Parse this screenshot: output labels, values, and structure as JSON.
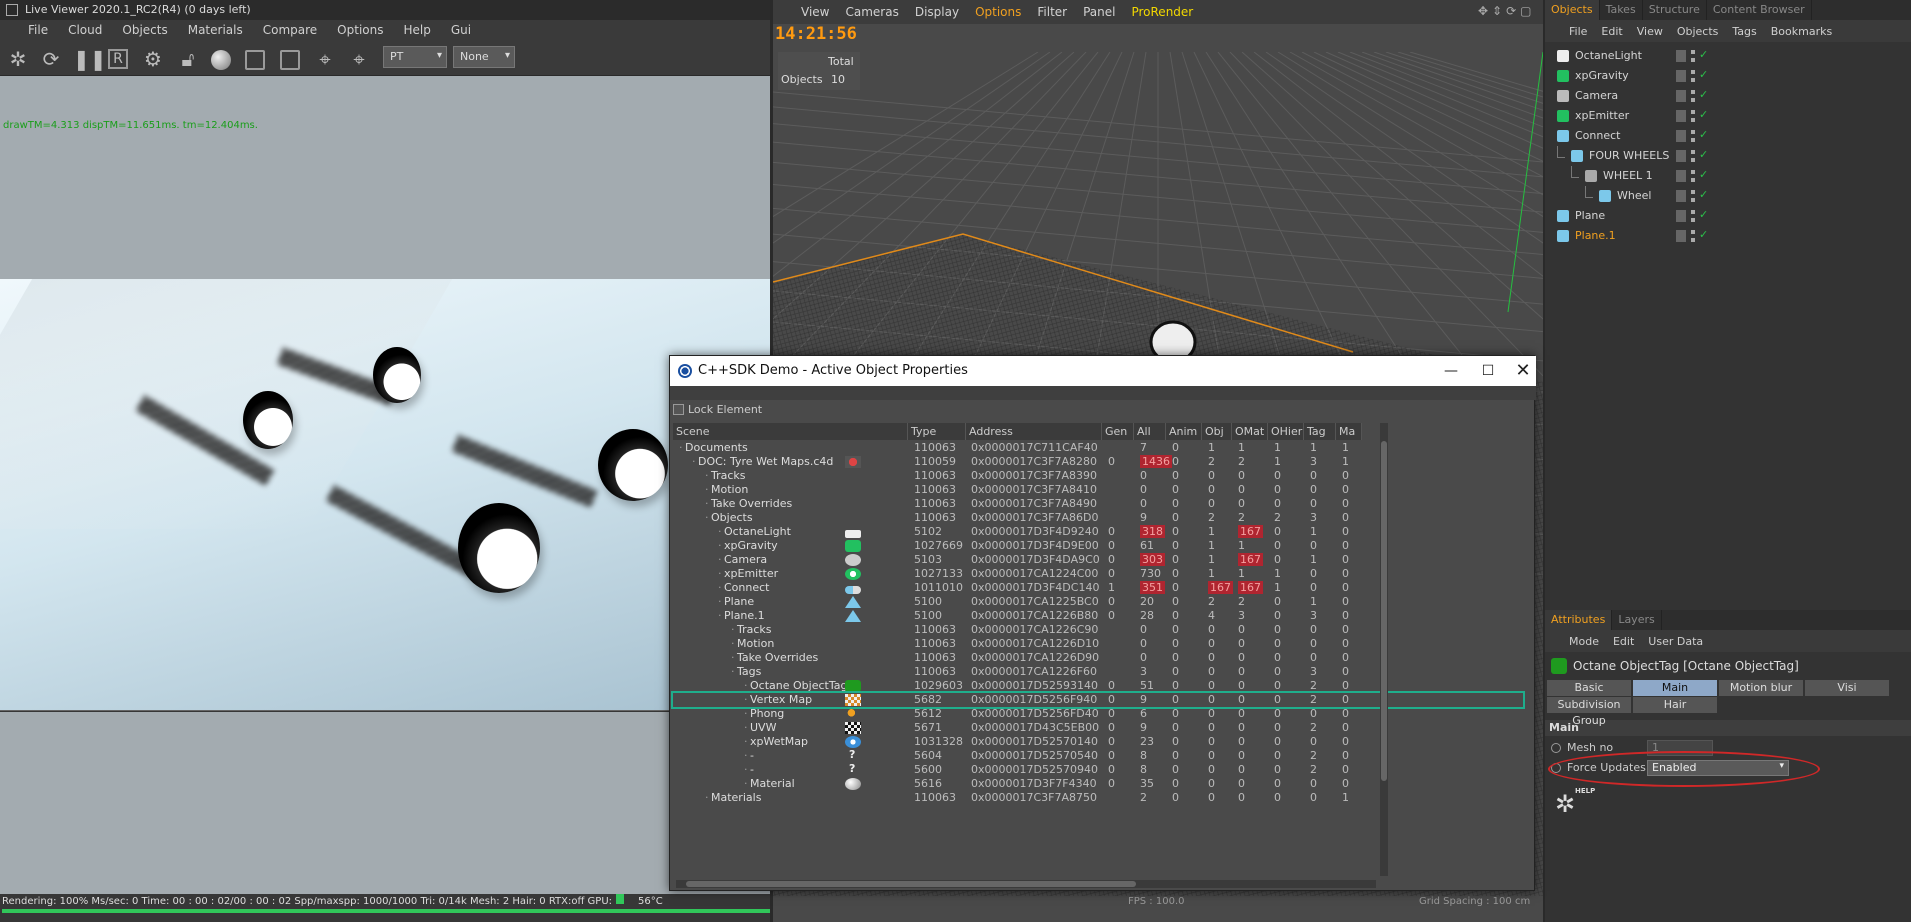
{
  "live_viewer": {
    "title": "Live Viewer 2020.1_RC2(R4) (0 days left)",
    "menu": [
      "File",
      "Cloud",
      "Objects",
      "Materials",
      "Compare",
      "Options",
      "Help",
      "Gui"
    ],
    "toolbar_icons": [
      "octane-logo-icon",
      "refresh-icon",
      "pause-icon",
      "region-icon",
      "settings-icon",
      "lock-icon",
      "material-ball-icon",
      "square-icon",
      "square-icon",
      "pin-p-icon",
      "pin-m-icon"
    ],
    "toolbar_region_label": "R",
    "mode_dropdown": "PT",
    "second_dropdown": "None",
    "stats": "drawTM=4.313 dispTM=11.651ms.   tm=12.404ms.",
    "status": "Rendering: 100%  Ms/sec: 0   Time: 00 : 00 : 02/00 : 00 : 02  Spp/maxspp: 1000/1000   Tri: 0/14k   Mesh: 2  Hair: 0   RTX:off       GPU:",
    "gpu_temp": "56°C",
    "progress": 1.0
  },
  "editor": {
    "menu": [
      "View",
      "Cameras",
      "Display",
      "Options",
      "Filter",
      "Panel",
      "ProRender"
    ],
    "active_menu": "Options",
    "clock": "14:21:56",
    "hud_header": "Total",
    "hud_label": "Objects",
    "hud_value": "10",
    "fps": "FPS : 100.0",
    "grid_spacing": "Grid Spacing : 100 cm"
  },
  "object_manager": {
    "tabs": [
      "Objects",
      "Takes",
      "Structure",
      "Content Browser"
    ],
    "menu": [
      "File",
      "Edit",
      "View",
      "Objects",
      "Tags",
      "Bookmarks"
    ],
    "objects": [
      {
        "name": "OctaneLight",
        "depth": 0,
        "color": "#eeeeee"
      },
      {
        "name": "xpGravity",
        "depth": 0,
        "color": "#22c060"
      },
      {
        "name": "Camera",
        "depth": 0,
        "color": "#bbbbbb"
      },
      {
        "name": "xpEmitter",
        "depth": 0,
        "color": "#22c060"
      },
      {
        "name": "Connect",
        "depth": 0,
        "color": "#7cc8ea"
      },
      {
        "name": "FOUR WHEELS",
        "depth": 1,
        "color": "#7cc8ea"
      },
      {
        "name": "WHEEL 1",
        "depth": 2,
        "color": "#aaaaaa"
      },
      {
        "name": "Wheel",
        "depth": 3,
        "color": "#7cc8ea"
      },
      {
        "name": "Plane",
        "depth": 0,
        "color": "#7cc8ea"
      },
      {
        "name": "Plane.1",
        "depth": 0,
        "color": "#7cc8ea",
        "highlight": true
      }
    ]
  },
  "attributes": {
    "tabs": [
      "Attributes",
      "Layers"
    ],
    "menu": [
      "Mode",
      "Edit",
      "User Data"
    ],
    "object_title": "Octane ObjectTag [Octane ObjectTag]",
    "buttons_row1": [
      "Basic",
      "Main",
      "Motion blur",
      "Visi"
    ],
    "buttons_row2": [
      "Subdivision Group",
      "Hair"
    ],
    "active_button": "Main",
    "section": "Main",
    "field1_label": "Mesh no",
    "field1_value": "1",
    "field2_label": "Force Updates",
    "field2_value": "Enabled",
    "help_label": "HELP"
  },
  "dialog": {
    "title": "C++SDK Demo - Active Object Properties",
    "lock_label": "Lock Element",
    "columns": [
      "Scene",
      "Type",
      "Address",
      "Gen",
      "All",
      "Anim",
      "Obj",
      "OMat",
      "OHier",
      "Tag",
      "Ma"
    ],
    "rows": [
      {
        "name": "Documents",
        "depth": 0,
        "icon": "",
        "type": "110063",
        "addr": "0x0000017C711CAF40",
        "gen": "",
        "all": "7",
        "anim": "0",
        "obj": "1",
        "omat": "1",
        "ohier": "1",
        "tag": "1",
        "ma": "1"
      },
      {
        "name": "DOC: Tyre Wet Maps.c4d",
        "depth": 1,
        "icon": "doc-icon",
        "type": "110059",
        "addr": "0x0000017C3F7A8280",
        "gen": "0",
        "all": "1436",
        "all_red": true,
        "anim": "0",
        "obj": "2",
        "omat": "2",
        "ohier": "1",
        "tag": "3",
        "ma": "1"
      },
      {
        "name": "Tracks",
        "depth": 2,
        "icon": "",
        "type": "110063",
        "addr": "0x0000017C3F7A8390",
        "gen": "",
        "all": "0",
        "anim": "0",
        "obj": "0",
        "omat": "0",
        "ohier": "0",
        "tag": "0",
        "ma": "0"
      },
      {
        "name": "Motion",
        "depth": 2,
        "icon": "",
        "type": "110063",
        "addr": "0x0000017C3F7A8410",
        "gen": "",
        "all": "0",
        "anim": "0",
        "obj": "0",
        "omat": "0",
        "ohier": "0",
        "tag": "0",
        "ma": "0"
      },
      {
        "name": "Take Overrides",
        "depth": 2,
        "icon": "",
        "type": "110063",
        "addr": "0x0000017C3F7A8490",
        "gen": "",
        "all": "0",
        "anim": "0",
        "obj": "0",
        "omat": "0",
        "ohier": "0",
        "tag": "0",
        "ma": "0"
      },
      {
        "name": "Objects",
        "depth": 2,
        "icon": "",
        "type": "110063",
        "addr": "0x0000017C3F7A86D0",
        "gen": "",
        "all": "9",
        "anim": "0",
        "obj": "2",
        "omat": "2",
        "ohier": "2",
        "tag": "3",
        "ma": "0"
      },
      {
        "name": "OctaneLight",
        "depth": 3,
        "icon": "light-icon",
        "type": "5102",
        "addr": "0x0000017D3F4D9240",
        "gen": "0",
        "all": "318",
        "all_red": true,
        "anim": "0",
        "obj": "1",
        "omat": "167",
        "omat_red": true,
        "ohier": "0",
        "tag": "1",
        "ma": "0"
      },
      {
        "name": "xpGravity",
        "depth": 3,
        "icon": "gravity-icon",
        "type": "1027669",
        "addr": "0x0000017D3F4D9E00",
        "gen": "0",
        "all": "61",
        "anim": "0",
        "obj": "1",
        "omat": "1",
        "ohier": "0",
        "tag": "0",
        "ma": "0"
      },
      {
        "name": "Camera",
        "depth": 3,
        "icon": "camera-icon",
        "type": "5103",
        "addr": "0x0000017D3F4DA9C0",
        "gen": "0",
        "all": "303",
        "all_red": true,
        "anim": "0",
        "obj": "1",
        "omat": "167",
        "omat_red": true,
        "ohier": "0",
        "tag": "1",
        "ma": "0"
      },
      {
        "name": "xpEmitter",
        "depth": 3,
        "icon": "emitter-icon",
        "type": "1027133",
        "addr": "0x0000017CA1224C00",
        "gen": "0",
        "all": "730",
        "anim": "0",
        "obj": "1",
        "omat": "1",
        "ohier": "1",
        "tag": "0",
        "ma": "0"
      },
      {
        "name": "Connect",
        "depth": 3,
        "icon": "connect-icon",
        "type": "1011010",
        "addr": "0x0000017D3F4DC140",
        "gen": "1",
        "all": "351",
        "all_red": true,
        "anim": "0",
        "obj": "167",
        "obj_red": true,
        "omat": "167",
        "omat_red": true,
        "ohier": "1",
        "tag": "0",
        "ma": "0"
      },
      {
        "name": "Plane",
        "depth": 3,
        "icon": "plane-icon",
        "type": "5100",
        "addr": "0x0000017CA1225BC0",
        "gen": "0",
        "all": "20",
        "anim": "0",
        "obj": "2",
        "omat": "2",
        "ohier": "0",
        "tag": "1",
        "ma": "0"
      },
      {
        "name": "Plane.1",
        "depth": 3,
        "icon": "plane-icon",
        "type": "5100",
        "addr": "0x0000017CA1226B80",
        "gen": "0",
        "all": "28",
        "anim": "0",
        "obj": "4",
        "omat": "3",
        "ohier": "0",
        "tag": "3",
        "ma": "0"
      },
      {
        "name": "Tracks",
        "depth": 4,
        "icon": "",
        "type": "110063",
        "addr": "0x0000017CA1226C90",
        "gen": "",
        "all": "0",
        "anim": "0",
        "obj": "0",
        "omat": "0",
        "ohier": "0",
        "tag": "0",
        "ma": "0"
      },
      {
        "name": "Motion",
        "depth": 4,
        "icon": "",
        "type": "110063",
        "addr": "0x0000017CA1226D10",
        "gen": "",
        "all": "0",
        "anim": "0",
        "obj": "0",
        "omat": "0",
        "ohier": "0",
        "tag": "0",
        "ma": "0"
      },
      {
        "name": "Take Overrides",
        "depth": 4,
        "icon": "",
        "type": "110063",
        "addr": "0x0000017CA1226D90",
        "gen": "",
        "all": "0",
        "anim": "0",
        "obj": "0",
        "omat": "0",
        "ohier": "0",
        "tag": "0",
        "ma": "0"
      },
      {
        "name": "Tags",
        "depth": 4,
        "icon": "",
        "type": "110063",
        "addr": "0x0000017CA1226F60",
        "gen": "",
        "all": "3",
        "anim": "0",
        "obj": "0",
        "omat": "0",
        "ohier": "0",
        "tag": "3",
        "ma": "0"
      },
      {
        "name": "Octane ObjectTag",
        "depth": 5,
        "icon": "octane-tag-icon",
        "type": "1029603",
        "addr": "0x0000017D52593140",
        "gen": "0",
        "all": "51",
        "anim": "0",
        "obj": "0",
        "omat": "0",
        "ohier": "0",
        "tag": "2",
        "ma": "0"
      },
      {
        "name": "Vertex Map",
        "depth": 5,
        "icon": "vertex-map-icon",
        "type": "5682",
        "addr": "0x0000017D5256F940",
        "gen": "0",
        "all": "9",
        "anim": "0",
        "obj": "0",
        "omat": "0",
        "ohier": "0",
        "tag": "2",
        "ma": "0",
        "selected": true
      },
      {
        "name": "Phong",
        "depth": 5,
        "icon": "phong-icon",
        "type": "5612",
        "addr": "0x0000017D5256FD40",
        "gen": "0",
        "all": "6",
        "anim": "0",
        "obj": "0",
        "omat": "0",
        "ohier": "0",
        "tag": "0",
        "ma": "0"
      },
      {
        "name": "UVW",
        "depth": 5,
        "icon": "uvw-icon",
        "type": "5671",
        "addr": "0x0000017D43C5EB00",
        "gen": "0",
        "all": "9",
        "anim": "0",
        "obj": "0",
        "omat": "0",
        "ohier": "0",
        "tag": "2",
        "ma": "0"
      },
      {
        "name": "xpWetMap",
        "depth": 5,
        "icon": "wetmap-icon",
        "type": "1031328",
        "addr": "0x0000017D52570140",
        "gen": "0",
        "all": "23",
        "anim": "0",
        "obj": "0",
        "omat": "0",
        "ohier": "0",
        "tag": "0",
        "ma": "0"
      },
      {
        "name": "-",
        "depth": 5,
        "icon": "question-icon",
        "type": "5604",
        "addr": "0x0000017D52570540",
        "gen": "0",
        "all": "8",
        "anim": "0",
        "obj": "0",
        "omat": "0",
        "ohier": "0",
        "tag": "2",
        "ma": "0"
      },
      {
        "name": "-",
        "depth": 5,
        "icon": "question-icon",
        "type": "5600",
        "addr": "0x0000017D52570940",
        "gen": "0",
        "all": "8",
        "anim": "0",
        "obj": "0",
        "omat": "0",
        "ohier": "0",
        "tag": "2",
        "ma": "0"
      },
      {
        "name": "Material",
        "depth": 5,
        "icon": "material-icon",
        "type": "5616",
        "addr": "0x0000017D3F7F4340",
        "gen": "0",
        "all": "35",
        "anim": "0",
        "obj": "0",
        "omat": "0",
        "ohier": "0",
        "tag": "0",
        "ma": "0"
      },
      {
        "name": "Materials",
        "depth": 2,
        "icon": "",
        "type": "110063",
        "addr": "0x0000017C3F7A8750",
        "gen": "",
        "all": "2",
        "anim": "0",
        "obj": "0",
        "omat": "0",
        "ohier": "0",
        "tag": "0",
        "ma": "1"
      }
    ]
  }
}
